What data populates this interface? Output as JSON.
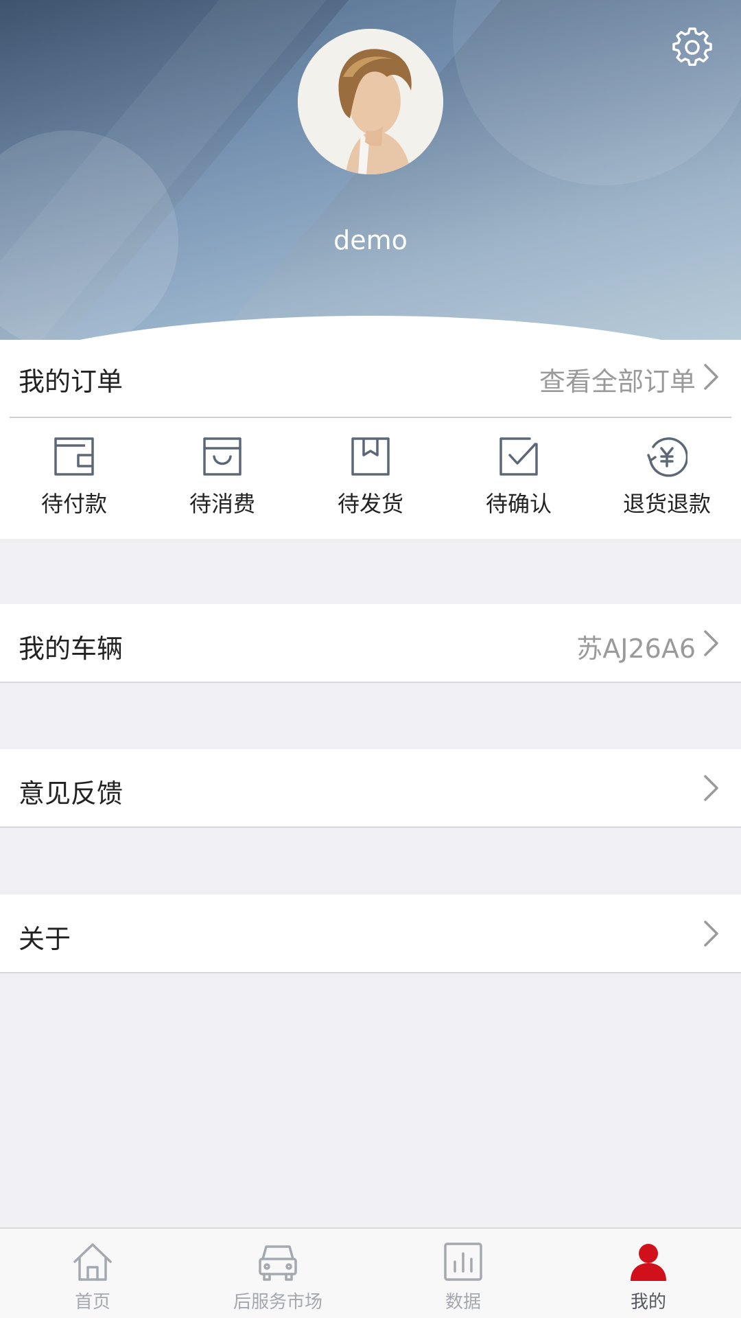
{
  "profile": {
    "username": "demo",
    "settings_icon": "gear-icon"
  },
  "orders": {
    "title": "我的订单",
    "view_all": "查看全部订单",
    "statuses": [
      {
        "label": "待付款",
        "icon": "wallet-icon"
      },
      {
        "label": "待消费",
        "icon": "shopping-bag-icon"
      },
      {
        "label": "待发货",
        "icon": "package-icon"
      },
      {
        "label": "待确认",
        "icon": "check-box-icon"
      },
      {
        "label": "退货退款",
        "icon": "refund-yen-icon"
      }
    ]
  },
  "vehicle": {
    "title": "我的车辆",
    "plate": "苏AJ26A6"
  },
  "feedback": {
    "title": "意见反馈"
  },
  "about": {
    "title": "关于"
  },
  "tabbar": {
    "items": [
      {
        "label": "首页",
        "icon": "home-icon"
      },
      {
        "label": "后服务市场",
        "icon": "car-icon"
      },
      {
        "label": "数据",
        "icon": "bar-chart-icon"
      },
      {
        "label": "我的",
        "icon": "user-icon",
        "active": true
      }
    ],
    "active_color": "#d0111b",
    "inactive_color": "#a4a9b0"
  }
}
